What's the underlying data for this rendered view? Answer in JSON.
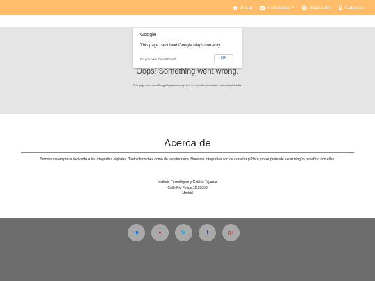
{
  "nav": {
    "items": [
      {
        "label": "Inicio",
        "icon": "home-icon"
      },
      {
        "label": "Contenido",
        "icon": "camera-icon",
        "caret": "▾"
      },
      {
        "label": "Acerca de",
        "icon": "eye-icon"
      },
      {
        "label": "Contacto",
        "icon": "phone-icon"
      }
    ]
  },
  "map_error": {
    "brand": "Google",
    "message": "This page can't load Google Maps correctly.",
    "owner_link": "Do you own this website?",
    "ok_label": "OK",
    "title": "Oops! Something went wrong.",
    "subtitle": "This page didn't load Google Maps correctly. See the JavaScript console for technical details."
  },
  "about": {
    "title": "Acerca de",
    "description": "Somos una empresa dedicada a las fotografías digitales. Tanto de coches como de la naturaleza. Nuestras fotografías son de carácter público, no se pretende sacar ningún beneficio con ellas.",
    "address": [
      "Instituto Tecnológico y Gráfico Tajamar",
      "Calle Pio Felipe,12.28038",
      "Madrid"
    ]
  },
  "footer": {
    "social": [
      {
        "name": "linkedin",
        "glyph": "in",
        "color": "#1a6bb8"
      },
      {
        "name": "pinterest",
        "glyph": "●",
        "color": "#cb2027"
      },
      {
        "name": "twitter",
        "glyph": "🐦",
        "color": "#1da1f2"
      },
      {
        "name": "facebook",
        "glyph": "f",
        "color": "#3b5998"
      },
      {
        "name": "googleplus",
        "glyph": "g+",
        "color": "#dd4b39"
      }
    ]
  }
}
